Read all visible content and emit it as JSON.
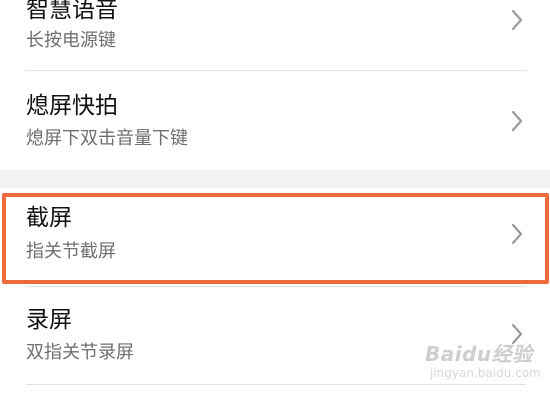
{
  "settings_list": {
    "items": [
      {
        "title": "智慧语音",
        "subtitle": "长按电源键"
      },
      {
        "title": "熄屏快拍",
        "subtitle": "熄屏下双击音量下键"
      },
      {
        "title": "截屏",
        "subtitle": "指关节截屏"
      },
      {
        "title": "录屏",
        "subtitle": "双指关节录屏"
      }
    ]
  },
  "highlight": {
    "item": "截屏",
    "color": "#ee6a3c"
  },
  "watermark": {
    "text": "Baidu经验",
    "sub": "jingyan.baidu.com"
  },
  "icons": {
    "row_arrow": "chevron-right-icon"
  }
}
